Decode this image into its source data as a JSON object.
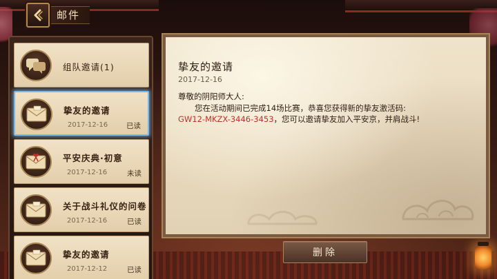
{
  "header": {
    "title": "邮件"
  },
  "mail_list": [
    {
      "title": "组队邀请(1)",
      "date": "",
      "status": "",
      "icon": "chat-bubbles-icon",
      "type": "group"
    },
    {
      "title": "挚友的邀请",
      "date": "2017-12-16",
      "status": "已读",
      "icon": "envelope-icon",
      "type": "mail",
      "selected": true
    },
    {
      "title": "平安庆典·初意",
      "date": "2017-12-16",
      "status": "未读",
      "icon": "gift-envelope-icon",
      "type": "mail"
    },
    {
      "title": "关于战斗礼仪的问卷",
      "date": "2017-12-16",
      "status": "已读",
      "icon": "envelope-icon",
      "type": "mail"
    },
    {
      "title": "挚友的邀请",
      "date": "2017-12-12",
      "status": "已读",
      "icon": "envelope-icon",
      "type": "mail"
    }
  ],
  "letter": {
    "title": "挚友的邀请",
    "date": "2017-12-16",
    "greeting": "尊敬的阴阳师大人:",
    "line1": "您在活动期间已完成14场比赛，恭喜您获得新的挚友激活码:",
    "code": "GW12-MKZX-3446-3453",
    "line2": "，您可以邀请挚友加入平安京，并肩战斗!"
  },
  "actions": {
    "delete_label": "删除"
  },
  "colors": {
    "code": "#c0302a",
    "selected_border": "#7ab8e8",
    "paper": "#efe3cb"
  }
}
